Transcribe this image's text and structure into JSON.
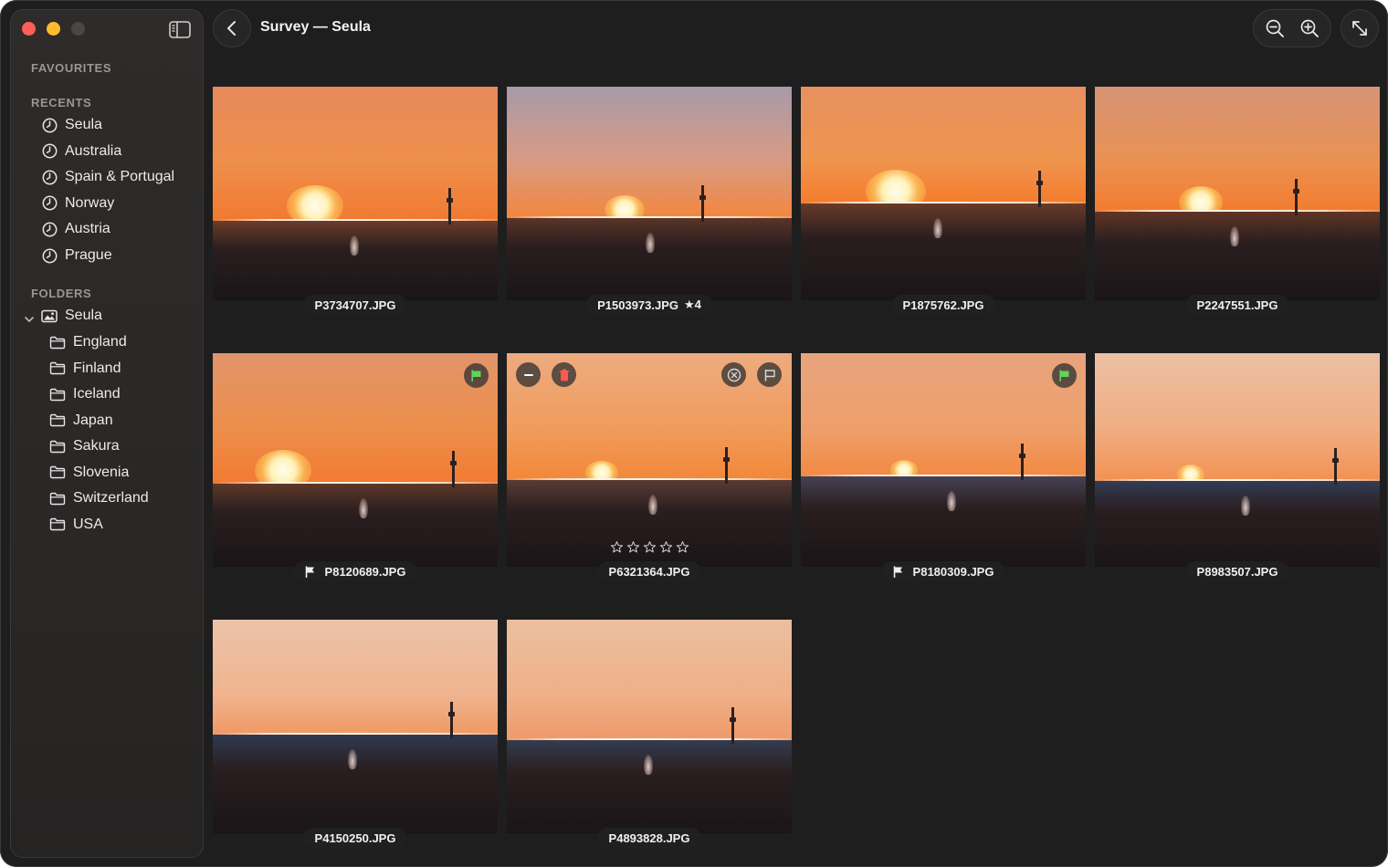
{
  "window": {
    "title": "Survey — Seula"
  },
  "sidebar": {
    "favourites_title": "FAVOURITES",
    "recents_title": "RECENTS",
    "recents": [
      "Seula",
      "Australia",
      "Spain & Portugal",
      "Norway",
      "Austria",
      "Prague"
    ],
    "folders_title": "FOLDERS",
    "root_folder": "Seula",
    "subfolders": [
      "England",
      "Finland",
      "Iceland",
      "Japan",
      "Sakura",
      "Slovenia",
      "Switzerland",
      "USA"
    ]
  },
  "toolbar": {
    "back_icon": "chevron-left-icon",
    "zoom_out_icon": "zoom-out-icon",
    "zoom_in_icon": "zoom-in-icon",
    "expand_icon": "expand-icon"
  },
  "photos": [
    {
      "filename": "P3734707.JPG"
    },
    {
      "filename": "P1503973.JPG",
      "rating_label": "★4"
    },
    {
      "filename": "P1875762.JPG"
    },
    {
      "filename": "P2247551.JPG"
    },
    {
      "filename": "P8120689.JPG",
      "flagged": true
    },
    {
      "filename": "P6321364.JPG",
      "selected": true,
      "star_slots": 5
    },
    {
      "filename": "P8180309.JPG",
      "flagged": true
    },
    {
      "filename": "P8983507.JPG"
    },
    {
      "filename": "P4150250.JPG"
    },
    {
      "filename": "P4893828.JPG"
    }
  ],
  "colors": {
    "accent": "#3d7ee9",
    "flag_green": "#5fd35a",
    "delete_red": "#ff5a4f"
  }
}
